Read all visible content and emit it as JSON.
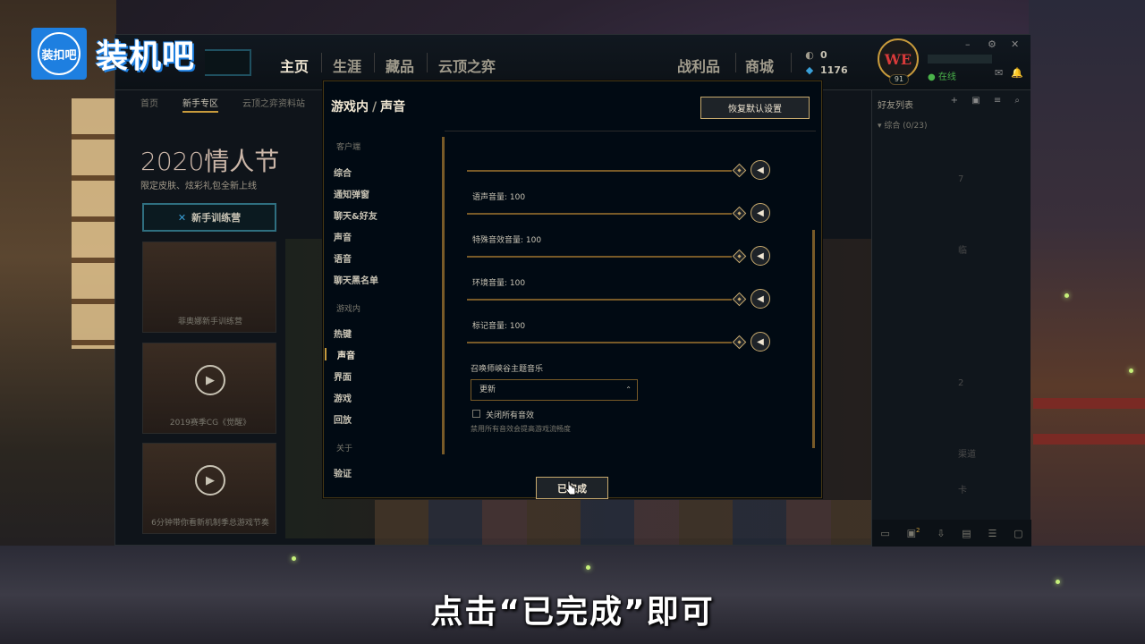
{
  "logo": {
    "badge": "装扣吧",
    "text": "装机吧"
  },
  "topnav": {
    "items": [
      "主页",
      "生涯",
      "藏品",
      "云顶之弈"
    ],
    "right_items": [
      "战利品",
      "商城"
    ],
    "currency_rp": "0",
    "currency_be": "1176"
  },
  "profile": {
    "avatar_text": "WE",
    "level": "91",
    "status": "在线"
  },
  "window_controls": {
    "minimize": "–",
    "settings": "⚙",
    "close": "✕"
  },
  "subnav": [
    "首页",
    "新手专区",
    "云顶之弈资料站"
  ],
  "banner": {
    "title": "2020情人节",
    "subtitle": "限定皮肤、炫彩礼包全新上线"
  },
  "home": {
    "train_button": "新手训练营",
    "cards": [
      "菲奥娜新手训练营",
      "2019赛季CG《觉醒》",
      "6分钟带你看新机制季总游戏节奏"
    ]
  },
  "friends": {
    "header": "好友列表",
    "group": "综合 (0/23)",
    "side_letters": [
      "7",
      "临",
      "2",
      "渠道",
      "卡"
    ],
    "bottom_badge": "2"
  },
  "settings": {
    "title_parent": "游戏内",
    "title_current": "声音",
    "reset_button": "恢复默认设置",
    "sidebar": {
      "section_client": "客户端",
      "client_items": [
        "综合",
        "通知弹窗",
        "聊天&好友",
        "声音",
        "语音",
        "聊天黑名单"
      ],
      "section_ingame": "游戏内",
      "ingame_items": [
        "热键",
        "声音",
        "界面",
        "游戏",
        "回放"
      ],
      "section_about": "关于",
      "about_items": [
        "验证"
      ]
    },
    "sliders": [
      {
        "label": "",
        "value": 100
      },
      {
        "label": "语声音量: 100",
        "value": 100
      },
      {
        "label": "特殊音效音量: 100",
        "value": 100
      },
      {
        "label": "环境音量: 100",
        "value": 100
      },
      {
        "label": "标记音量: 100",
        "value": 100
      }
    ],
    "music_label": "召唤师峡谷主题音乐",
    "music_select": "更新",
    "mute_all_label": "关闭所有音效",
    "mute_all_desc": "禁用所有音效会提高游戏流畅度",
    "done_button": "已完成"
  },
  "caption": "点击“已完成”即可",
  "icons": {
    "mute": "speaker-icon",
    "rp": "rp-icon",
    "be": "blue-essence-icon",
    "cursor": "hand-cursor-icon"
  },
  "colors": {
    "gold": "#c8aa6e",
    "modal_bg": "#010a13",
    "online": "#4ab34a"
  }
}
